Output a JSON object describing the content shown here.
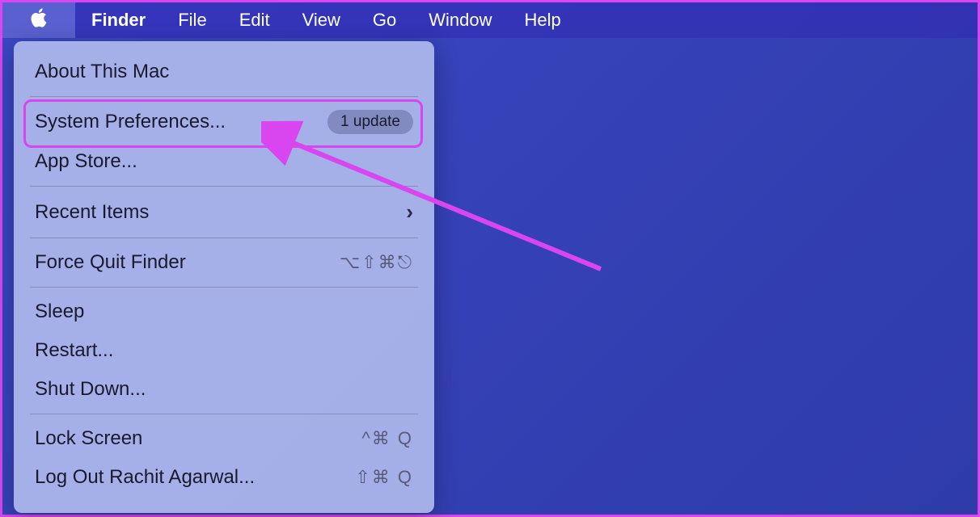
{
  "menubar": {
    "app_name": "Finder",
    "items": [
      "File",
      "Edit",
      "View",
      "Go",
      "Window",
      "Help"
    ]
  },
  "apple_menu": {
    "about": "About This Mac",
    "system_prefs": "System Preferences...",
    "update_badge": "1 update",
    "app_store": "App Store...",
    "recent_items": "Recent Items",
    "force_quit": "Force Quit Finder",
    "force_quit_shortcut": "⌥⇧⌘⎋",
    "sleep": "Sleep",
    "restart": "Restart...",
    "shut_down": "Shut Down...",
    "lock_screen": "Lock Screen",
    "lock_screen_shortcut": "^⌘ Q",
    "log_out": "Log Out Rachit Agarwal...",
    "log_out_shortcut": "⇧⌘ Q"
  }
}
